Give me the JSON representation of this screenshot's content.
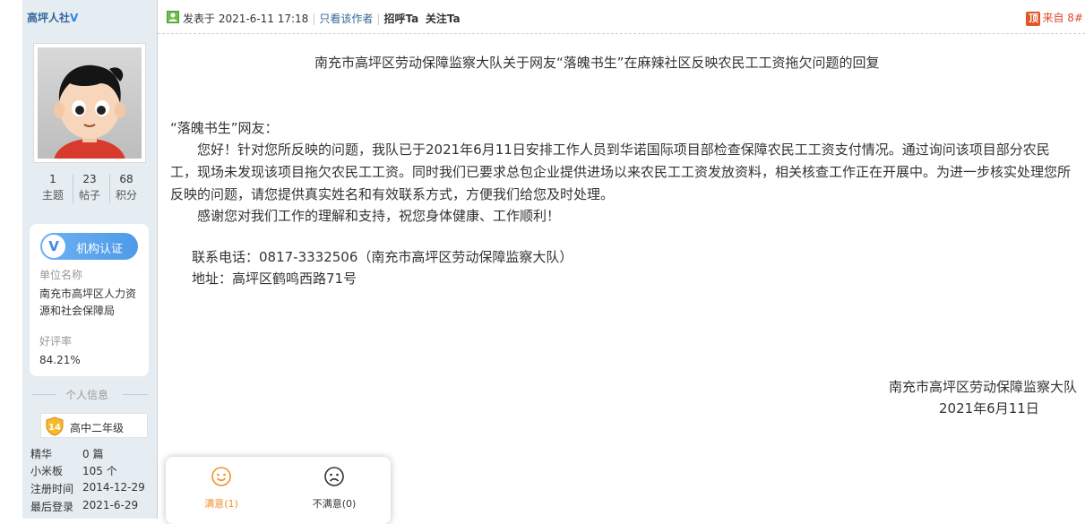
{
  "user": {
    "name": "高坪人社",
    "verified_mark": "V",
    "stats": [
      {
        "value": "1",
        "label": "主题"
      },
      {
        "value": "23",
        "label": "帖子"
      },
      {
        "value": "68",
        "label": "积分"
      }
    ],
    "certification": {
      "badge": "V",
      "label": "机构认证",
      "unit_label": "单位名称",
      "unit_name": "南充市高坪区人力资源和社会保障局",
      "rating_label": "好评率",
      "rating_value": "84.21%"
    },
    "personal_info_title": "个人信息",
    "level": {
      "number": "14",
      "name": "高中二年级"
    },
    "details": [
      {
        "key": "精华",
        "value": "0 篇"
      },
      {
        "key": "小米板",
        "value": "105 个"
      },
      {
        "key": "注册时间",
        "value": "2014-12-29"
      },
      {
        "key": "最后登录",
        "value": "2021-6-29"
      }
    ]
  },
  "post": {
    "posted_at": "发表于 2021-6-11 17:18",
    "only_author": "只看该作者",
    "greet": "招呼Ta",
    "follow": "关注Ta",
    "source_icon": "顶",
    "floor": "来自 8#",
    "title": "南充市高坪区劳动保障监察大队关于网友“落魄书生”在麻辣社区反映农民工工资拖欠问题的回复",
    "greeting": "“落魄书生”网友：",
    "paragraph1": "　　您好！针对您所反映的问题，我队已于2021年6月11日安排工作人员到华诺国际项目部检查保障农民工工资支付情况。通过询问该项目部分农民工，现场未发现该项目拖欠农民工工资。同时我们已要求总包企业提供进场以来农民工工资发放资料，相关核查工作正在开展中。为进一步核实处理您所反映的问题，请您提供真实姓名和有效联系方式，方便我们给您及时处理。",
    "paragraph2": "　　感谢您对我们工作的理解和支持，祝您身体健康、工作顺利！",
    "phone": "联系电话：0817-3332506（南充市高坪区劳动保障监察大队）",
    "address": "地址：高坪区鹤鸣西路71号",
    "signature_org": "南充市高坪区劳动保障监察大队",
    "signature_date": "2021年6月11日"
  },
  "rating": {
    "satisfied": "满意(1)",
    "unsatisfied": "不满意(0)",
    "satisfied_color": "#f0902a"
  }
}
